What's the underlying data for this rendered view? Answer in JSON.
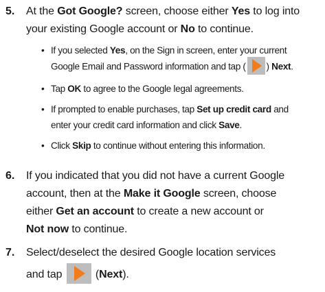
{
  "steps": [
    {
      "number": "5.",
      "line1_pre": "At the ",
      "line1_bold": "Got Google?",
      "line1_mid": " screen, choose either ",
      "line1_yes": "Yes",
      "line1_post": " to log into",
      "line2_pre": "your existing Google account or ",
      "line2_no": "No",
      "line2_post": " to continue.",
      "bullets": [
        {
          "b1_pre": "If you selected ",
          "b1_yes": "Yes",
          "b1_mid": ", on the Sign in screen, enter your current",
          "b1_line2": "Google Email and Password information and tap (",
          "b1_close": ") ",
          "b1_next": "Next",
          "b1_end": "."
        },
        {
          "b2_pre": "Tap ",
          "b2_ok": "OK",
          "b2_post": " to agree to the Google legal agreements."
        },
        {
          "b3_pre": "If prompted to enable purchases, tap ",
          "b3_setup": "Set up credit card",
          "b3_mid": " and",
          "b3_line2": "enter your credit card information and click ",
          "b3_save": "Save",
          "b3_end": "."
        },
        {
          "b4_pre": "Click ",
          "b4_skip": "Skip",
          "b4_post": " to continue without entering this information."
        }
      ]
    },
    {
      "number": "6.",
      "l1": "If you indicated that you did not have a current Google",
      "l2_pre": "account, then at the ",
      "l2_bold": "Make it Google",
      "l2_post": " screen, choose",
      "l3_pre": "either ",
      "l3_bold": "Get an account",
      "l3_post": " to create a new account or",
      "l4_bold": "Not now",
      "l4_post": " to continue."
    },
    {
      "number": "7.",
      "l1": "Select/deselect the desired Google location services",
      "l2_pre": "and tap ",
      "l2_open": " (",
      "l2_bold": "Next",
      "l2_end": ")."
    }
  ],
  "bullet_glyph": "•",
  "icon_color": "#bdbdbd",
  "arrow_color": "#f07c1e"
}
